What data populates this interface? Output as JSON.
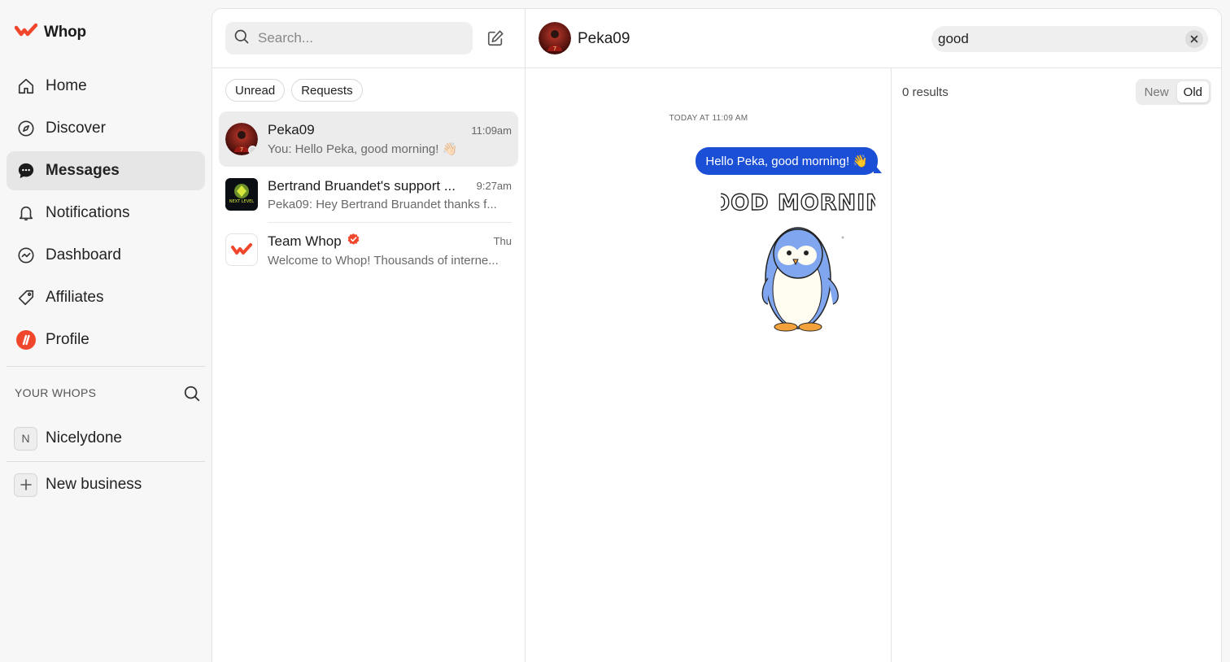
{
  "brand": {
    "name": "Whop"
  },
  "nav": [
    {
      "label": "Home",
      "icon": "home-icon"
    },
    {
      "label": "Discover",
      "icon": "compass-icon"
    },
    {
      "label": "Messages",
      "icon": "chat-bubble-icon",
      "active": true
    },
    {
      "label": "Notifications",
      "icon": "bell-icon"
    },
    {
      "label": "Dashboard",
      "icon": "chart-icon"
    },
    {
      "label": "Affiliates",
      "icon": "tag-icon"
    },
    {
      "label": "Profile",
      "icon": "profile-icon"
    }
  ],
  "whops_section": {
    "label": "YOUR WHOPS",
    "items": [
      {
        "initial": "N",
        "label": "Nicelydone"
      }
    ],
    "new_business": "New business"
  },
  "conversations": {
    "search_placeholder": "Search...",
    "filters": [
      "Unread",
      "Requests"
    ],
    "items": [
      {
        "name": "Peka09",
        "time": "11:09am",
        "preview": "You: Hello Peka, good morning! 👋🏻",
        "active": true
      },
      {
        "name": "Bertrand Bruandet's support ...",
        "time": "9:27am",
        "preview": "Peka09: Hey Bertrand Bruandet thanks f..."
      },
      {
        "name": "Team Whop",
        "time": "Thu",
        "preview": "Welcome to Whop! Thousands of interne...",
        "verified": true
      }
    ]
  },
  "chat": {
    "title": "Peka09",
    "search_value": "good",
    "day_label": "TODAY AT 11:09 AM",
    "message": "Hello Peka, good morning! 👋",
    "sticker_text": "GOOD MORNING"
  },
  "results": {
    "count": "0 results",
    "sort": {
      "new": "New",
      "old": "Old",
      "selected": "Old"
    }
  },
  "colors": {
    "brand": "#f0472c",
    "bubble": "#1a4fd6",
    "verified": "#f0472c"
  }
}
